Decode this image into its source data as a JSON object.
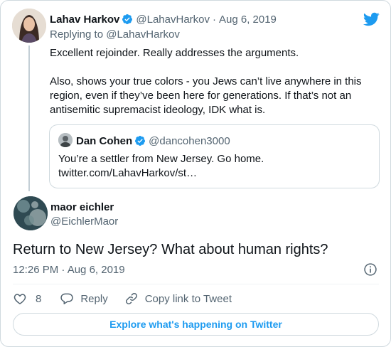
{
  "colors": {
    "brand_blue": "#1d9bf0",
    "text_primary": "#0f1419",
    "text_secondary": "#536471",
    "border": "#cfd9de"
  },
  "icons": {
    "brand": "twitter-bird-icon",
    "verified": "verified-badge-icon",
    "like": "heart-icon",
    "reply": "speech-bubble-icon",
    "copy_link": "link-icon",
    "info": "info-icon"
  },
  "parent_tweet": {
    "display_name": "Lahav Harkov",
    "handle": "@LahavHarkov",
    "separator": "·",
    "date": "Aug 6, 2019",
    "replying_to": "Replying to @LahavHarkov",
    "paragraphs": [
      "Excellent rejoinder. Really addresses the arguments.",
      "Also, shows your true colors - you Jews can’t live anywhere in this region, even if they’ve been here for generations. If that’s not an antisemitic supremacist ideology, IDK what is."
    ],
    "quoted_tweet": {
      "display_name": "Dan Cohen",
      "handle": "@dancohen3000",
      "text": "You’re a settler from New Jersey. Go home.",
      "link": "twitter.com/LahavHarkov/st…"
    }
  },
  "main_tweet": {
    "display_name": "maor eichler",
    "handle": "@EichlerMaor",
    "text": "Return to New Jersey? What about human rights?",
    "timestamp": "12:26 PM · Aug 6, 2019"
  },
  "actions": {
    "like_count": "8",
    "reply_label": "Reply",
    "copy_link_label": "Copy link to Tweet"
  },
  "explore_button": "Explore what's happening on Twitter"
}
